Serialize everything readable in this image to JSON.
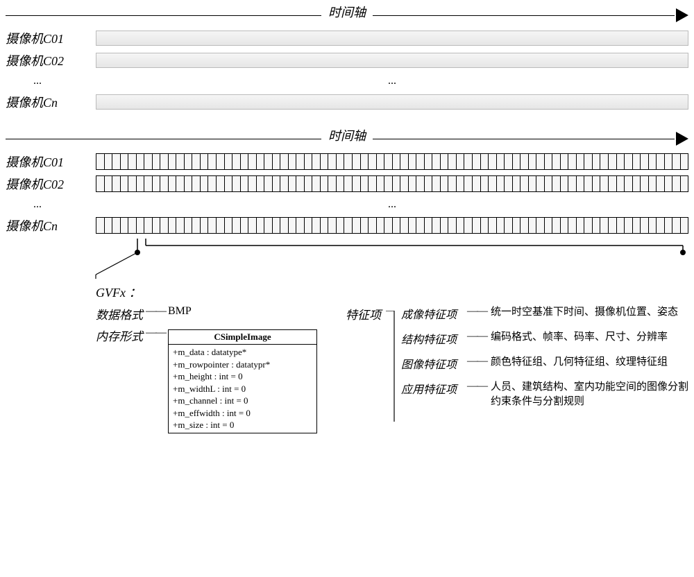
{
  "axis_label": "时间轴",
  "cameras": [
    "摄像机C01",
    "摄像机C02",
    "摄像机Cn"
  ],
  "ellipsis": "...",
  "gvfx": "GVFx ：",
  "data_format_key": "数据格式",
  "data_format_val": "BMP",
  "mem_form_key": "内存形式",
  "class_box": {
    "title": "CSimpleImage",
    "rows": [
      "+m_data : datatype*",
      "+m_rowpointer : datatypr*",
      "+m_height : int = 0",
      "+m_widthL : int = 0",
      "+m_channel : int = 0",
      "+m_effwidth : int = 0",
      "+m_size : int = 0"
    ]
  },
  "feature_key": "特征项",
  "features": [
    {
      "k": "成像特征项",
      "v": "统一时空基准下时间、摄像机位置、姿态"
    },
    {
      "k": "结构特征项",
      "v": "编码格式、帧率、码率、尺寸、分辨率"
    },
    {
      "k": "图像特征项",
      "v": "颜色特征组、几何特征组、纹理特征组"
    },
    {
      "k": "应用特征项",
      "v": "人员、建筑结构、室内功能空间的图像分割约束条件与分割规则"
    }
  ],
  "dash": "——"
}
